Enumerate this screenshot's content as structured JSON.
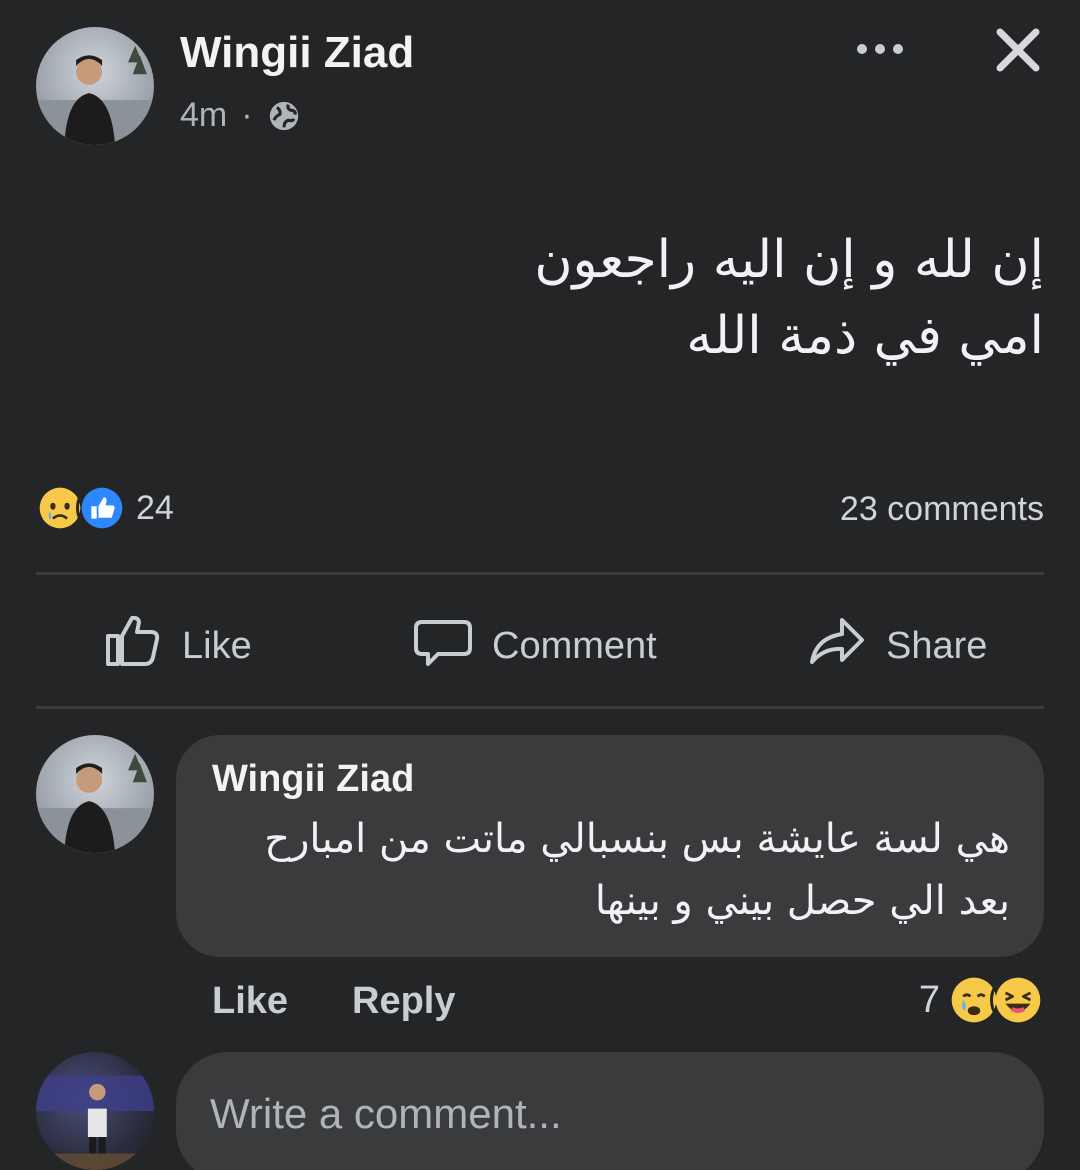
{
  "post": {
    "author": "Wingii Ziad",
    "time": "4m",
    "separator": "·",
    "privacy_icon": "globe-icon",
    "text_lines": [
      "إن لله و إن اليه راجعون",
      "امي في ذمة الله"
    ],
    "reactions": {
      "icons": [
        "sad-face-icon",
        "like-reaction-icon"
      ],
      "count": "24"
    },
    "comments_count": "23 comments"
  },
  "actions": {
    "like": "Like",
    "comment": "Comment",
    "share": "Share"
  },
  "comment": {
    "author": "Wingii Ziad",
    "text_lines": [
      "هي لسة عايشة بس بنسبالي ماتت من امبارح",
      "بعد الي حصل بيني و بينها"
    ],
    "like_label": "Like",
    "reply_label": "Reply",
    "reaction_count": "7",
    "reaction_icons": [
      "crying-face-icon",
      "laughing-face-icon"
    ]
  },
  "composer": {
    "placeholder": "Write a comment..."
  },
  "colors": {
    "background": "#242526",
    "bubble": "#3a3b3c",
    "like_blue": "#2d88ff",
    "emoji_yellow": "#f7c948"
  }
}
